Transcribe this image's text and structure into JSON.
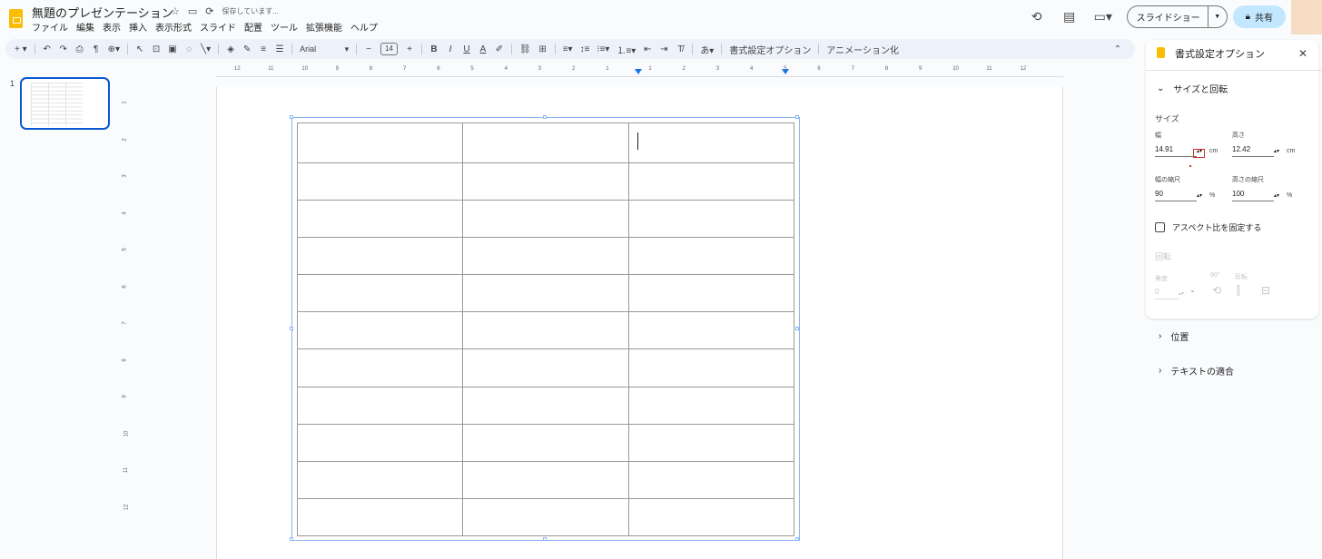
{
  "header": {
    "doc_title": "無題のプレゼンテーション",
    "save_status": "保存しています...",
    "menu": [
      "ファイル",
      "編集",
      "表示",
      "挿入",
      "表示形式",
      "スライド",
      "配置",
      "ツール",
      "拡張機能",
      "ヘルプ"
    ],
    "slideshow_label": "スライドショー",
    "share_label": "共有"
  },
  "toolbar": {
    "font_name": "Arial",
    "font_size": "14",
    "format_options_label": "書式設定オプション",
    "animation_label": "アニメーション化"
  },
  "ruler": {
    "h_ticks": [
      "12",
      "11",
      "10",
      "9",
      "8",
      "7",
      "6",
      "5",
      "4",
      "3",
      "2",
      "1",
      "1",
      "2",
      "3",
      "4",
      "5",
      "6",
      "7",
      "8",
      "9",
      "10",
      "11",
      "12"
    ],
    "v_ticks": [
      "1",
      "2",
      "3",
      "4",
      "5",
      "6",
      "7",
      "8",
      "9",
      "10",
      "11",
      "12"
    ]
  },
  "filmstrip": {
    "slide_number": "1"
  },
  "table": {
    "rows": 11,
    "cols": 3
  },
  "panel": {
    "title": "書式設定オプション",
    "size_rotation_section": "サイズと回転",
    "size_label": "サイズ",
    "width_label": "幅",
    "width_value": "14.91",
    "height_label": "高さ",
    "height_value": "12.42",
    "unit_cm": "cm",
    "width_scale_label": "幅の縮尺",
    "width_scale_value": "90",
    "height_scale_label": "高さの縮尺",
    "height_scale_value": "100",
    "unit_percent": "%",
    "lock_aspect_label": "アスペクト比を固定する",
    "rotation_label": "回転",
    "angle_label": "角度",
    "angle_value": "0",
    "angle_unit": "°",
    "rotate90_label": "90°",
    "flip_label": "反転",
    "position_section": "位置",
    "text_fit_section": "テキストの適合"
  }
}
